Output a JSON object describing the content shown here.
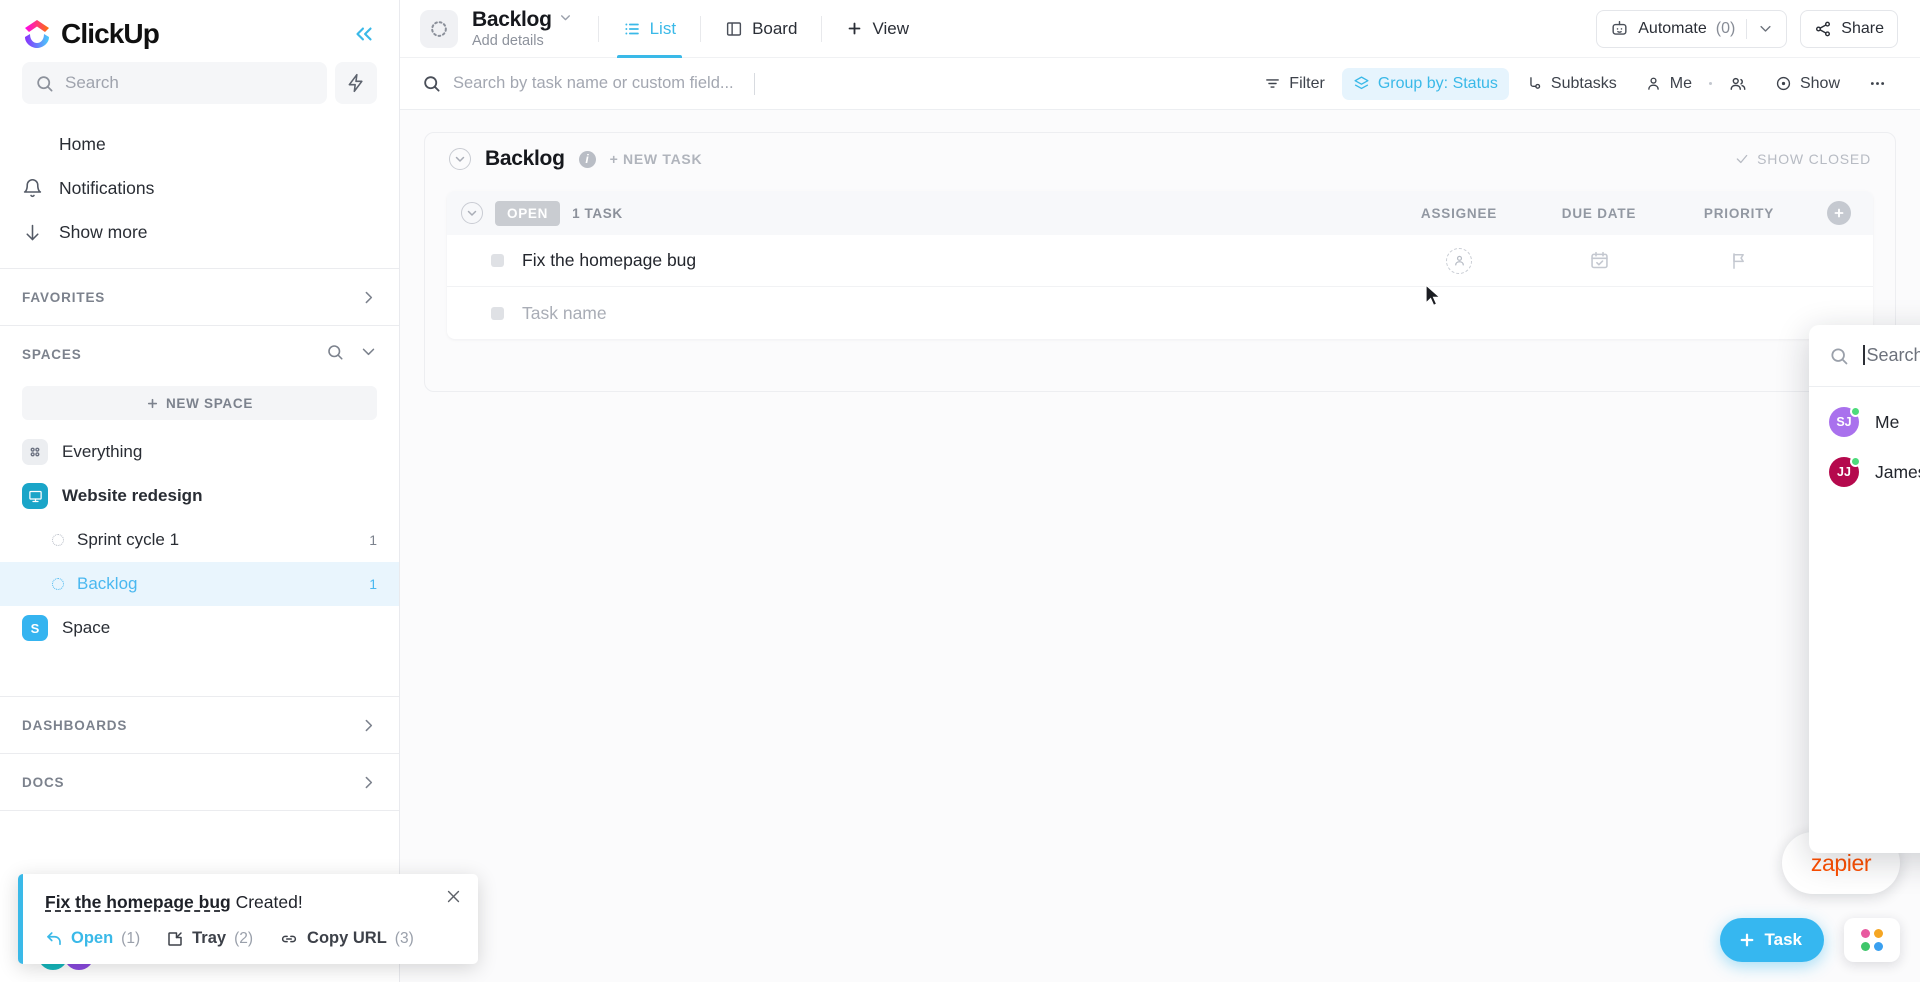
{
  "brand": {
    "name": "ClickUp",
    "collapse_icon": "chevrons-left-icon"
  },
  "sidebar": {
    "search": {
      "placeholder": "Search",
      "icon": "search-icon"
    },
    "bolt_icon": "lightning-bolt-icon",
    "nav": [
      {
        "label": "Home",
        "icon": "home-icon"
      },
      {
        "label": "Notifications",
        "icon": "bell-icon"
      },
      {
        "label": "Show more",
        "icon": "arrow-down-icon"
      }
    ],
    "favorites": {
      "label": "FAVORITES",
      "chevron": "chevron-right-icon"
    },
    "spaces": {
      "label": "SPACES",
      "search_icon": "search-icon",
      "chevron": "chevron-down-icon",
      "new_space_label": "NEW SPACE",
      "items": [
        {
          "label": "Everything",
          "icon": "grid-icon",
          "kind": "everything"
        },
        {
          "label": "Website redesign",
          "icon": "monitor-icon",
          "kind": "space",
          "color": "#1aa5c8",
          "bold": true
        },
        {
          "label": "Sprint cycle 1",
          "kind": "list",
          "count": "1",
          "active": false
        },
        {
          "label": "Backlog",
          "kind": "list",
          "count": "1",
          "active": true
        },
        {
          "label": "Space",
          "icon": "S",
          "kind": "space",
          "color": "#35b4f0"
        }
      ]
    },
    "dashboards": {
      "label": "DASHBOARDS",
      "chevron": "chevron-right-icon"
    },
    "docs": {
      "label": "DOCS",
      "chevron": "chevron-right-icon"
    }
  },
  "toast": {
    "task_name": "Fix the homepage bug",
    "suffix": " Created!",
    "close_icon": "close-icon",
    "actions": [
      {
        "label": "Open",
        "num": "(1)",
        "icon": "reply-arrow-icon",
        "primary": true
      },
      {
        "label": "Tray",
        "num": "(2)",
        "icon": "tray-icon",
        "primary": false
      },
      {
        "label": "Copy URL",
        "num": "(3)",
        "icon": "link-icon",
        "primary": false
      }
    ]
  },
  "topbar": {
    "list_icon": "dotted-circle-icon",
    "title": "Backlog",
    "title_caret": "chevron-down-icon",
    "add_details": "Add details",
    "tabs": [
      {
        "label": "List",
        "icon": "list-icon",
        "active": true
      },
      {
        "label": "Board",
        "icon": "board-icon",
        "active": false
      },
      {
        "label": "View",
        "icon": "plus-icon",
        "active": false
      }
    ],
    "automate": {
      "label": "Automate",
      "count": "(0)",
      "icon": "robot-icon",
      "caret": "chevron-down-icon"
    },
    "share": {
      "label": "Share",
      "icon": "share-icon"
    }
  },
  "toolbar": {
    "search_placeholder": "Search by task name or custom field...",
    "search_icon": "search-icon",
    "buttons": [
      {
        "label": "Filter",
        "icon": "filter-icon",
        "highlight": false
      },
      {
        "label": "Group by: Status",
        "icon": "layers-icon",
        "highlight": true
      },
      {
        "label": "Subtasks",
        "icon": "subtask-icon",
        "highlight": false
      },
      {
        "label": "Me",
        "icon": "person-icon",
        "highlight": false
      },
      {
        "label": "",
        "icon": "people-icon",
        "highlight": false
      },
      {
        "label": "Show",
        "icon": "eye-circle-icon",
        "highlight": false
      },
      {
        "label": "",
        "icon": "more-horizontal-icon",
        "highlight": false
      }
    ]
  },
  "panel": {
    "title": "Backlog",
    "info_icon": "info-icon",
    "new_task_label": "+ NEW TASK",
    "show_closed_label": "SHOW CLOSED",
    "show_closed_icon": "check-icon",
    "group": {
      "status": "OPEN",
      "count_label": "1 TASK",
      "columns": [
        "ASSIGNEE",
        "DUE DATE",
        "PRIORITY"
      ],
      "add_column_icon": "plus-circle-icon",
      "rows": [
        {
          "name": "Fix the homepage bug",
          "placeholder": false
        },
        {
          "name": "Task name",
          "placeholder": true
        }
      ]
    }
  },
  "assignee_dropdown": {
    "search_placeholder": "Search",
    "search_icon": "search-icon",
    "people": [
      {
        "name": "Me",
        "initials": "SJ",
        "color": "#a971ed",
        "online": true
      },
      {
        "name": "James Jonas",
        "initials": "JJ",
        "color": "#b5094d",
        "online": true
      }
    ]
  },
  "bottom_right": {
    "zapier_label": "zapier",
    "task_button": "Task",
    "task_button_icon": "plus-icon",
    "apps_icon": "apps-grid-icon",
    "apps_colors": [
      "#e85aa0",
      "#f5a623",
      "#3fc66b",
      "#3aa0f0"
    ]
  }
}
